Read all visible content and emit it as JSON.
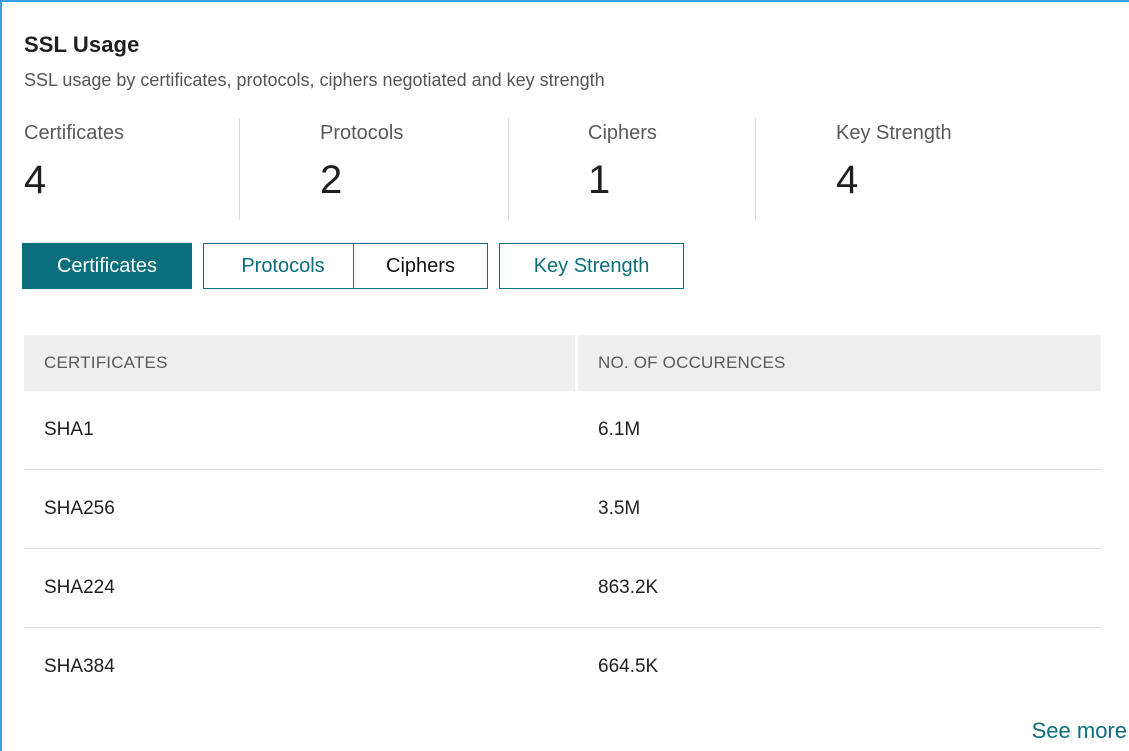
{
  "card": {
    "title": "SSL Usage",
    "subtitle": "SSL usage by certificates, protocols, ciphers negotiated and key strength"
  },
  "summary": [
    {
      "label": "Certificates",
      "value": "4"
    },
    {
      "label": "Protocols",
      "value": "2"
    },
    {
      "label": "Ciphers",
      "value": "1"
    },
    {
      "label": "Key Strength",
      "value": "4"
    }
  ],
  "tabs": [
    {
      "label": "Certificates",
      "active": true
    },
    {
      "label": "Protocols",
      "active": false
    },
    {
      "label": "Ciphers",
      "active": false
    },
    {
      "label": "Key Strength",
      "active": false
    }
  ],
  "table": {
    "columns": [
      "CERTIFICATES",
      "NO. OF OCCURENCES"
    ],
    "rows": [
      [
        "SHA1",
        "6.1M"
      ],
      [
        "SHA256",
        "3.5M"
      ],
      [
        "SHA224",
        "863.2K"
      ],
      [
        "SHA384",
        "664.5K"
      ]
    ]
  },
  "footer": {
    "see_more": "See more"
  },
  "colors": {
    "accent": "#0b6e7c",
    "panel_border": "#3a9fdd",
    "header_bg": "#efefef"
  }
}
